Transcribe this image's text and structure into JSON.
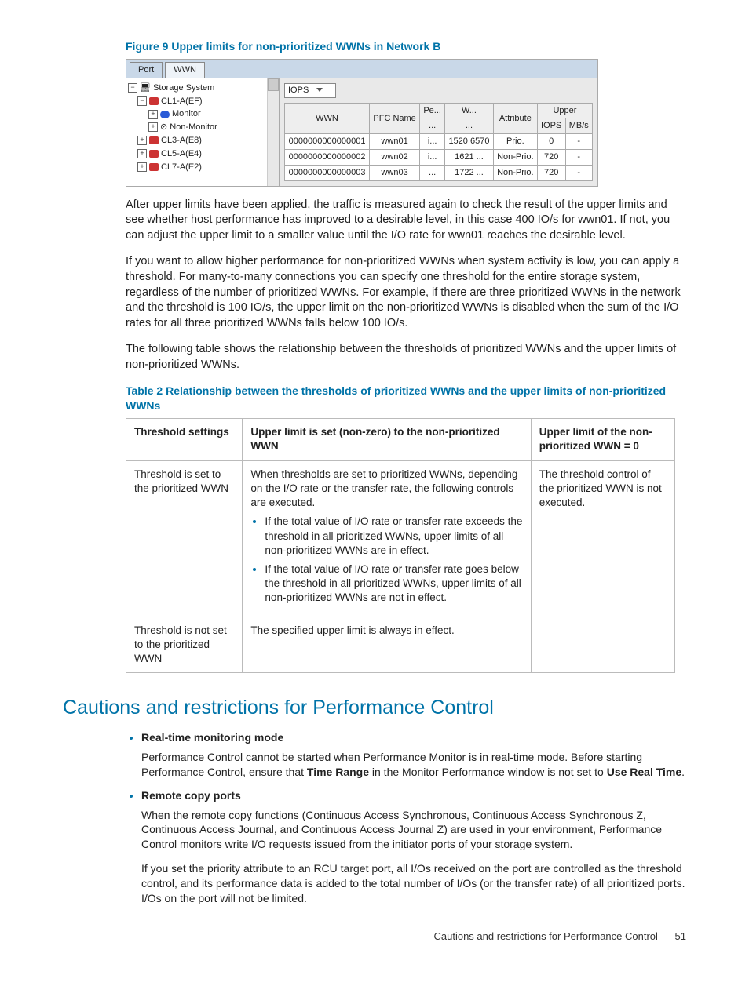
{
  "figure": {
    "caption": "Figure 9 Upper limits for non-prioritized WWNs in Network B",
    "tabs": {
      "port": "Port",
      "wwn": "WWN"
    },
    "tree": {
      "root": "Storage System",
      "selected": "CL1-A(EF)",
      "children": [
        "Monitor",
        "Non-Monitor"
      ],
      "siblings": [
        "CL3-A(E8)",
        "CL5-A(E4)",
        "CL7-A(E2)"
      ]
    },
    "dropdown": "IOPS",
    "grid": {
      "headers": {
        "wwn": "WWN",
        "pfc": "PFC Name",
        "pe": "Pe...",
        "w": "W...",
        "attr": "Attribute",
        "upper": "Upper",
        "iops": "IOPS",
        "mbs": "MB/s"
      },
      "rows": [
        {
          "wwn": "0000000000000001",
          "pfc": "wwn01",
          "pe": "i...",
          "w": "1520",
          "w2": "6570",
          "attr": "Prio.",
          "iops": "0",
          "mbs": "-"
        },
        {
          "wwn": "0000000000000002",
          "pfc": "wwn02",
          "pe": "i...",
          "w": "1621",
          "w2": "...",
          "attr": "Non-Prio.",
          "iops": "720",
          "mbs": "-"
        },
        {
          "wwn": "0000000000000003",
          "pfc": "wwn03",
          "pe": "...",
          "w": "1722",
          "w2": "...",
          "attr": "Non-Prio.",
          "iops": "720",
          "mbs": "-"
        }
      ]
    }
  },
  "paras": {
    "p1": "After upper limits have been applied, the traffic is measured again to check the result of the upper limits and see whether host performance has improved to a desirable level, in this case 400 IO/s for wwn01. If not, you can adjust the upper limit to a smaller value until the I/O rate for wwn01 reaches the desirable level.",
    "p2": "If you want to allow higher performance for non-prioritized WWNs when system activity is low, you can apply a threshold. For many-to-many connections you can specify one threshold for the entire storage system, regardless of the number of prioritized WWNs. For example, if there are three prioritized WWNs in the network and the threshold is 100 IO/s, the upper limit on the non-prioritized WWNs is disabled when the sum of the I/O rates for all three prioritized WWNs falls below 100 IO/s.",
    "p3": "The following table shows the relationship between the thresholds of prioritized WWNs and the upper limits of non-prioritized WWNs."
  },
  "table2": {
    "caption": "Table 2 Relationship between the thresholds of prioritized WWNs and the upper limits of non-prioritized WWNs",
    "h1": "Threshold settings",
    "h2": "Upper limit is set (non-zero) to the non-prioritized WWN",
    "h3": "Upper limit of the non-prioritized WWN = 0",
    "r1c1": "Threshold is set to the prioritized WWN",
    "r1c2_intro": "When thresholds are set to prioritized WWNs, depending on the I/O rate or the transfer rate, the following controls are executed.",
    "r1c2_b1": "If the total value of I/O rate or transfer rate exceeds the threshold in all prioritized WWNs, upper limits of all non-prioritized WWNs are in effect.",
    "r1c2_b2": "If the total value of I/O rate or transfer rate goes below the threshold in all prioritized WWNs, upper limits of all non-prioritized WWNs are not in effect.",
    "r1c3": "The threshold control of the prioritized WWN is not executed.",
    "r2c1": "Threshold is not set to the prioritized WWN",
    "r2c2": "The specified upper limit is always in effect."
  },
  "section": {
    "title": "Cautions and restrictions for Performance Control",
    "items": [
      {
        "title": "Real-time monitoring mode",
        "body_pre": "Performance Control cannot be started when Performance Monitor is in real-time mode. Before starting Performance Control, ensure that ",
        "bold1": "Time Range",
        "body_mid": " in the Monitor Performance window is not set to ",
        "bold2": "Use Real Time",
        "body_post": "."
      },
      {
        "title": "Remote copy ports",
        "body1": "When the remote copy functions (Continuous Access Synchronous, Continuous Access Synchronous Z, Continuous Access Journal, and Continuous Access Journal Z) are used in your environment, Performance Control monitors write I/O requests issued from the initiator ports of your storage system.",
        "body2": "If you set the priority attribute to an RCU target port, all I/Os received on the port are controlled as the threshold control, and its performance data is added to the total number of I/Os (or the transfer rate) of all prioritized ports. I/Os on the port will not be limited."
      }
    ]
  },
  "footer": {
    "text": "Cautions and restrictions for Performance Control",
    "page": "51"
  }
}
